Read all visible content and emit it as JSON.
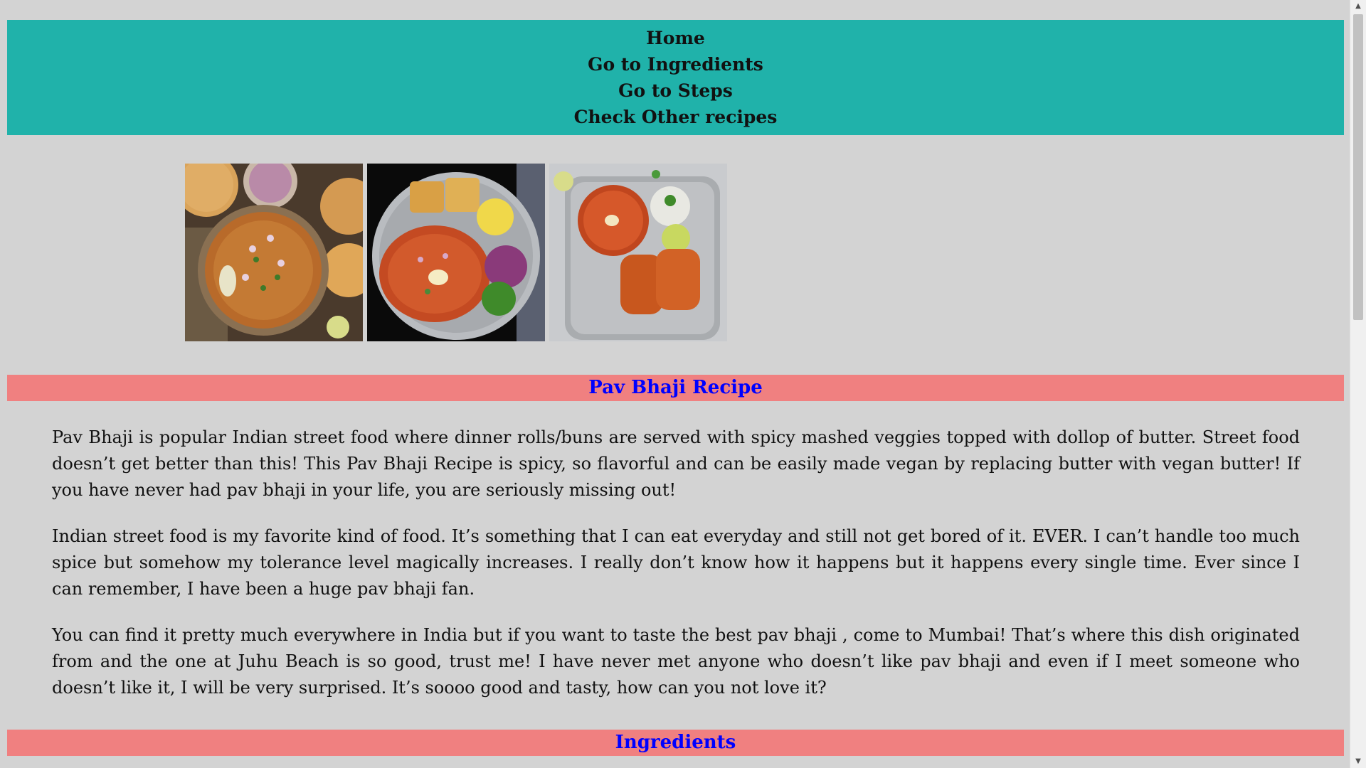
{
  "nav": {
    "links": [
      {
        "label": "Home"
      },
      {
        "label": "Go to Ingredients"
      },
      {
        "label": "Go to Steps"
      },
      {
        "label": "Check Other recipes"
      }
    ],
    "background": "#20b2aa"
  },
  "gallery": {
    "images": [
      {
        "name": "pav-bhaji-bowl-image"
      },
      {
        "name": "pav-bhaji-steel-plate-image"
      },
      {
        "name": "pav-bhaji-thali-image"
      }
    ]
  },
  "recipe": {
    "heading": "Pav Bhaji Recipe",
    "paragraphs": [
      "Pav Bhaji is popular Indian street food where dinner rolls/buns are served with spicy mashed veggies topped with dollop of butter. Street food doesn’t get better than this! This Pav Bhaji Recipe is spicy, so flavorful and can be easily made vegan by replacing butter with vegan butter! If you have never had pav bhaji in your life, you are seriously missing out!",
      "Indian street food is my favorite kind of food. It’s something that I can eat everyday and still not get bored of it. EVER. I can’t handle too much spice but somehow my tolerance level magically increases. I really don’t know how it happens but it happens every single time. Ever since I can remember, I have been a huge pav bhaji fan.",
      "You can find it pretty much everywhere in India but if you want to taste the best pav bhaji , come to Mumbai! That’s where this dish originated from and the one at Juhu Beach is so good, trust me! I have never met anyone who doesn’t like pav bhaji and even if I meet someone who doesn’t like it, I will be very surprised. It’s soooo good and tasty, how can you not love it?"
    ]
  },
  "ingredients": {
    "heading": "Ingredients"
  },
  "colors": {
    "page_background": "#d3d3d3",
    "section_bar": "#f08080",
    "heading_text": "#0000ff"
  }
}
